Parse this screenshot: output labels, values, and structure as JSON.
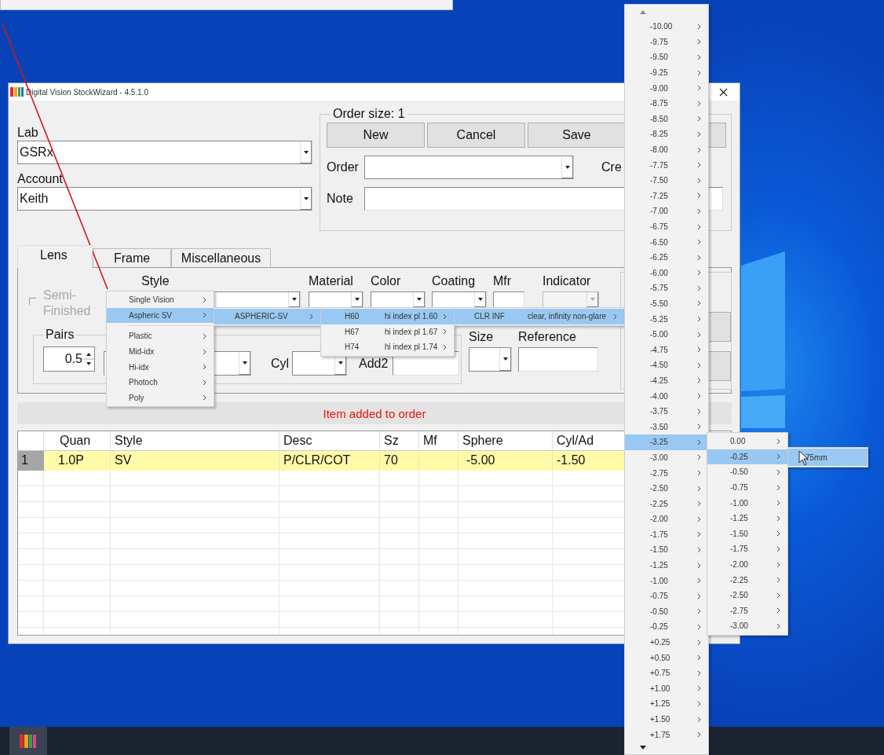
{
  "window": {
    "title": "Digital Vision StockWizard - 4.5.1.0"
  },
  "lab": {
    "label": "Lab",
    "value": "GSRx"
  },
  "account": {
    "label": "Account",
    "value": "Keith"
  },
  "order_group": {
    "legend": "Order size: 1",
    "buttons": [
      "New",
      "Cancel",
      "Save"
    ],
    "order_label": "Order",
    "created_label": "Cre",
    "note_label": "Note"
  },
  "tabs": [
    {
      "label": "Lens",
      "selected": true
    },
    {
      "label": "Frame",
      "selected": false
    },
    {
      "label": "Miscellaneous",
      "selected": false
    }
  ],
  "lens": {
    "semi_finished": {
      "label": "Semi-Finished",
      "checked": false,
      "disabled": true
    },
    "columns": [
      "Style",
      "Material",
      "Color",
      "Coating",
      "Mfr",
      "Indicator"
    ],
    "pairs": {
      "label": "Pairs",
      "value": "0.5"
    },
    "cyl_label": "Cyl",
    "add2_label": "Add2",
    "size_label": "Size",
    "reference_label": "Reference"
  },
  "status": "Item added to order",
  "table": {
    "columns": [
      "Quan",
      "Style",
      "Desc",
      "Sz",
      "Mf",
      "Sphere",
      "Cyl/Ad"
    ],
    "rows": [
      {
        "number": "1",
        "quan": "1.0P",
        "style": "SV",
        "desc": "P/CLR/COT",
        "sz": "70",
        "sphere": "-5.00",
        "cyl_ad": "-1.50",
        "selected": true
      }
    ]
  },
  "menus": [
    {
      "items": [
        {
          "kind": "item",
          "label": "Single Vision",
          "submenu": true,
          "selected": false
        },
        {
          "kind": "item",
          "label": "Aspheric SV",
          "submenu": true,
          "selected": true
        },
        {
          "kind": "separator"
        },
        {
          "kind": "item",
          "label": "Plastic",
          "submenu": true,
          "selected": false
        },
        {
          "kind": "item",
          "label": "Mid-idx",
          "submenu": true,
          "selected": false
        },
        {
          "kind": "item",
          "label": "Hi-idx",
          "submenu": true,
          "selected": false
        },
        {
          "kind": "item",
          "label": "Photoch",
          "submenu": true,
          "selected": false
        },
        {
          "kind": "item",
          "label": "Poly",
          "submenu": true,
          "selected": false
        }
      ]
    },
    {
      "items": [
        {
          "kind": "item",
          "label": "ASPHERIC-SV",
          "submenu": true,
          "selected": true
        }
      ]
    },
    {
      "items": [
        {
          "kind": "item",
          "label": "H60",
          "detail": "hi index pl 1.60",
          "submenu": true,
          "selected": true
        },
        {
          "kind": "item",
          "label": "H67",
          "detail": "hi index pl 1.67",
          "submenu": true,
          "selected": false
        },
        {
          "kind": "item",
          "label": "H74",
          "detail": "hi index pl 1.74",
          "submenu": true,
          "selected": false
        }
      ]
    },
    {
      "items": [
        {
          "kind": "item",
          "label": "CLR INF",
          "detail": "clear, infinity non-glare",
          "submenu": true,
          "selected": true
        }
      ]
    },
    {
      "scroll_arrows": true,
      "items": [
        {
          "kind": "item",
          "label": "-10.00",
          "submenu": true,
          "selected": false
        },
        {
          "kind": "item",
          "label": "-9.75",
          "submenu": true,
          "selected": false
        },
        {
          "kind": "item",
          "label": "-9.50",
          "submenu": true,
          "selected": false
        },
        {
          "kind": "item",
          "label": "-9.25",
          "submenu": true,
          "selected": false
        },
        {
          "kind": "item",
          "label": "-9.00",
          "submenu": true,
          "selected": false
        },
        {
          "kind": "item",
          "label": "-8.75",
          "submenu": true,
          "selected": false
        },
        {
          "kind": "item",
          "label": "-8.50",
          "submenu": true,
          "selected": false
        },
        {
          "kind": "item",
          "label": "-8.25",
          "submenu": true,
          "selected": false
        },
        {
          "kind": "item",
          "label": "-8.00",
          "submenu": true,
          "selected": false
        },
        {
          "kind": "item",
          "label": "-7.75",
          "submenu": true,
          "selected": false
        },
        {
          "kind": "item",
          "label": "-7.50",
          "submenu": true,
          "selected": false
        },
        {
          "kind": "item",
          "label": "-7.25",
          "submenu": true,
          "selected": false
        },
        {
          "kind": "item",
          "label": "-7.00",
          "submenu": true,
          "selected": false
        },
        {
          "kind": "item",
          "label": "-6.75",
          "submenu": true,
          "selected": false
        },
        {
          "kind": "item",
          "label": "-6.50",
          "submenu": true,
          "selected": false
        },
        {
          "kind": "item",
          "label": "-6.25",
          "submenu": true,
          "selected": false
        },
        {
          "kind": "item",
          "label": "-6.00",
          "submenu": true,
          "selected": false
        },
        {
          "kind": "item",
          "label": "-5.75",
          "submenu": true,
          "selected": false
        },
        {
          "kind": "item",
          "label": "-5.50",
          "submenu": true,
          "selected": false
        },
        {
          "kind": "item",
          "label": "-5.25",
          "submenu": true,
          "selected": false
        },
        {
          "kind": "item",
          "label": "-5.00",
          "submenu": true,
          "selected": false
        },
        {
          "kind": "item",
          "label": "-4.75",
          "submenu": true,
          "selected": false
        },
        {
          "kind": "item",
          "label": "-4.50",
          "submenu": true,
          "selected": false
        },
        {
          "kind": "item",
          "label": "-4.25",
          "submenu": true,
          "selected": false
        },
        {
          "kind": "item",
          "label": "-4.00",
          "submenu": true,
          "selected": false
        },
        {
          "kind": "item",
          "label": "-3.75",
          "submenu": true,
          "selected": false
        },
        {
          "kind": "item",
          "label": "-3.50",
          "submenu": true,
          "selected": false
        },
        {
          "kind": "item",
          "label": "-3.25",
          "submenu": true,
          "selected": true
        },
        {
          "kind": "item",
          "label": "-3.00",
          "submenu": true,
          "selected": false
        },
        {
          "kind": "item",
          "label": "-2.75",
          "submenu": true,
          "selected": false
        },
        {
          "kind": "item",
          "label": "-2.50",
          "submenu": true,
          "selected": false
        },
        {
          "kind": "item",
          "label": "-2.25",
          "submenu": true,
          "selected": false
        },
        {
          "kind": "item",
          "label": "-2.00",
          "submenu": true,
          "selected": false
        },
        {
          "kind": "item",
          "label": "-1.75",
          "submenu": true,
          "selected": false
        },
        {
          "kind": "item",
          "label": "-1.50",
          "submenu": true,
          "selected": false
        },
        {
          "kind": "item",
          "label": "-1.25",
          "submenu": true,
          "selected": false
        },
        {
          "kind": "item",
          "label": "-1.00",
          "submenu": true,
          "selected": false
        },
        {
          "kind": "item",
          "label": "-0.75",
          "submenu": true,
          "selected": false
        },
        {
          "kind": "item",
          "label": "-0.50",
          "submenu": true,
          "selected": false
        },
        {
          "kind": "item",
          "label": "-0.25",
          "submenu": true,
          "selected": false
        },
        {
          "kind": "item",
          "label": "+0.25",
          "submenu": true,
          "selected": false
        },
        {
          "kind": "item",
          "label": "+0.50",
          "submenu": true,
          "selected": false
        },
        {
          "kind": "item",
          "label": "+0.75",
          "submenu": true,
          "selected": false
        },
        {
          "kind": "item",
          "label": "+1.00",
          "submenu": true,
          "selected": false
        },
        {
          "kind": "item",
          "label": "+1.25",
          "submenu": true,
          "selected": false
        },
        {
          "kind": "item",
          "label": "+1.50",
          "submenu": true,
          "selected": false
        },
        {
          "kind": "item",
          "label": "+1.75",
          "submenu": true,
          "selected": false
        }
      ]
    },
    {
      "items": [
        {
          "kind": "item",
          "label": "0.00",
          "submenu": true,
          "selected": false
        },
        {
          "kind": "item",
          "label": "-0.25",
          "submenu": true,
          "selected": true
        },
        {
          "kind": "item",
          "label": "-0.50",
          "submenu": true,
          "selected": false
        },
        {
          "kind": "item",
          "label": "-0.75",
          "submenu": true,
          "selected": false
        },
        {
          "kind": "item",
          "label": "-1.00",
          "submenu": true,
          "selected": false
        },
        {
          "kind": "item",
          "label": "-1.25",
          "submenu": true,
          "selected": false
        },
        {
          "kind": "item",
          "label": "-1.50",
          "submenu": true,
          "selected": false
        },
        {
          "kind": "item",
          "label": "-1.75",
          "submenu": true,
          "selected": false
        },
        {
          "kind": "item",
          "label": "-2.00",
          "submenu": true,
          "selected": false
        },
        {
          "kind": "item",
          "label": "-2.25",
          "submenu": true,
          "selected": false
        },
        {
          "kind": "item",
          "label": "-2.50",
          "submenu": true,
          "selected": false
        },
        {
          "kind": "item",
          "label": "-2.75",
          "submenu": true,
          "selected": false
        },
        {
          "kind": "item",
          "label": "-3.00",
          "submenu": true,
          "selected": false
        }
      ]
    },
    {
      "items": [
        {
          "kind": "item",
          "label": "75mm",
          "submenu": false,
          "selected": true
        }
      ]
    }
  ]
}
